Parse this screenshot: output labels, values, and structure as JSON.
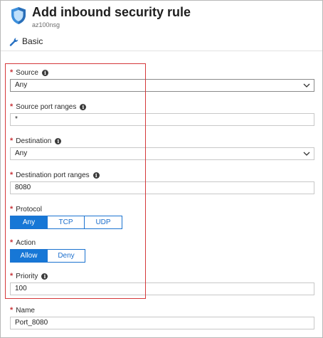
{
  "header": {
    "title": "Add inbound security rule",
    "subtitle": "az100nsg",
    "icon": "shield-icon"
  },
  "toolbar": {
    "mode_label": "Basic",
    "icon": "wrench-icon"
  },
  "form": {
    "source": {
      "label": "Source",
      "required": true,
      "value": "Any"
    },
    "source_port_ranges": {
      "label": "Source port ranges",
      "required": true,
      "value": "*"
    },
    "destination": {
      "label": "Destination",
      "required": true,
      "value": "Any"
    },
    "destination_port_ranges": {
      "label": "Destination port ranges",
      "required": true,
      "value": "8080"
    },
    "protocol": {
      "label": "Protocol",
      "required": true,
      "options": [
        "Any",
        "TCP",
        "UDP"
      ],
      "selected": "Any"
    },
    "action": {
      "label": "Action",
      "required": true,
      "options": [
        "Allow",
        "Deny"
      ],
      "selected": "Allow"
    },
    "priority": {
      "label": "Priority",
      "required": true,
      "value": "100"
    },
    "name": {
      "label": "Name",
      "required": true,
      "value": "Port_8080"
    }
  },
  "colors": {
    "accent": "#1777d6",
    "required_marker": "#c8353a",
    "highlight_box": "#d5383a",
    "shield": "#3c8fdc"
  }
}
